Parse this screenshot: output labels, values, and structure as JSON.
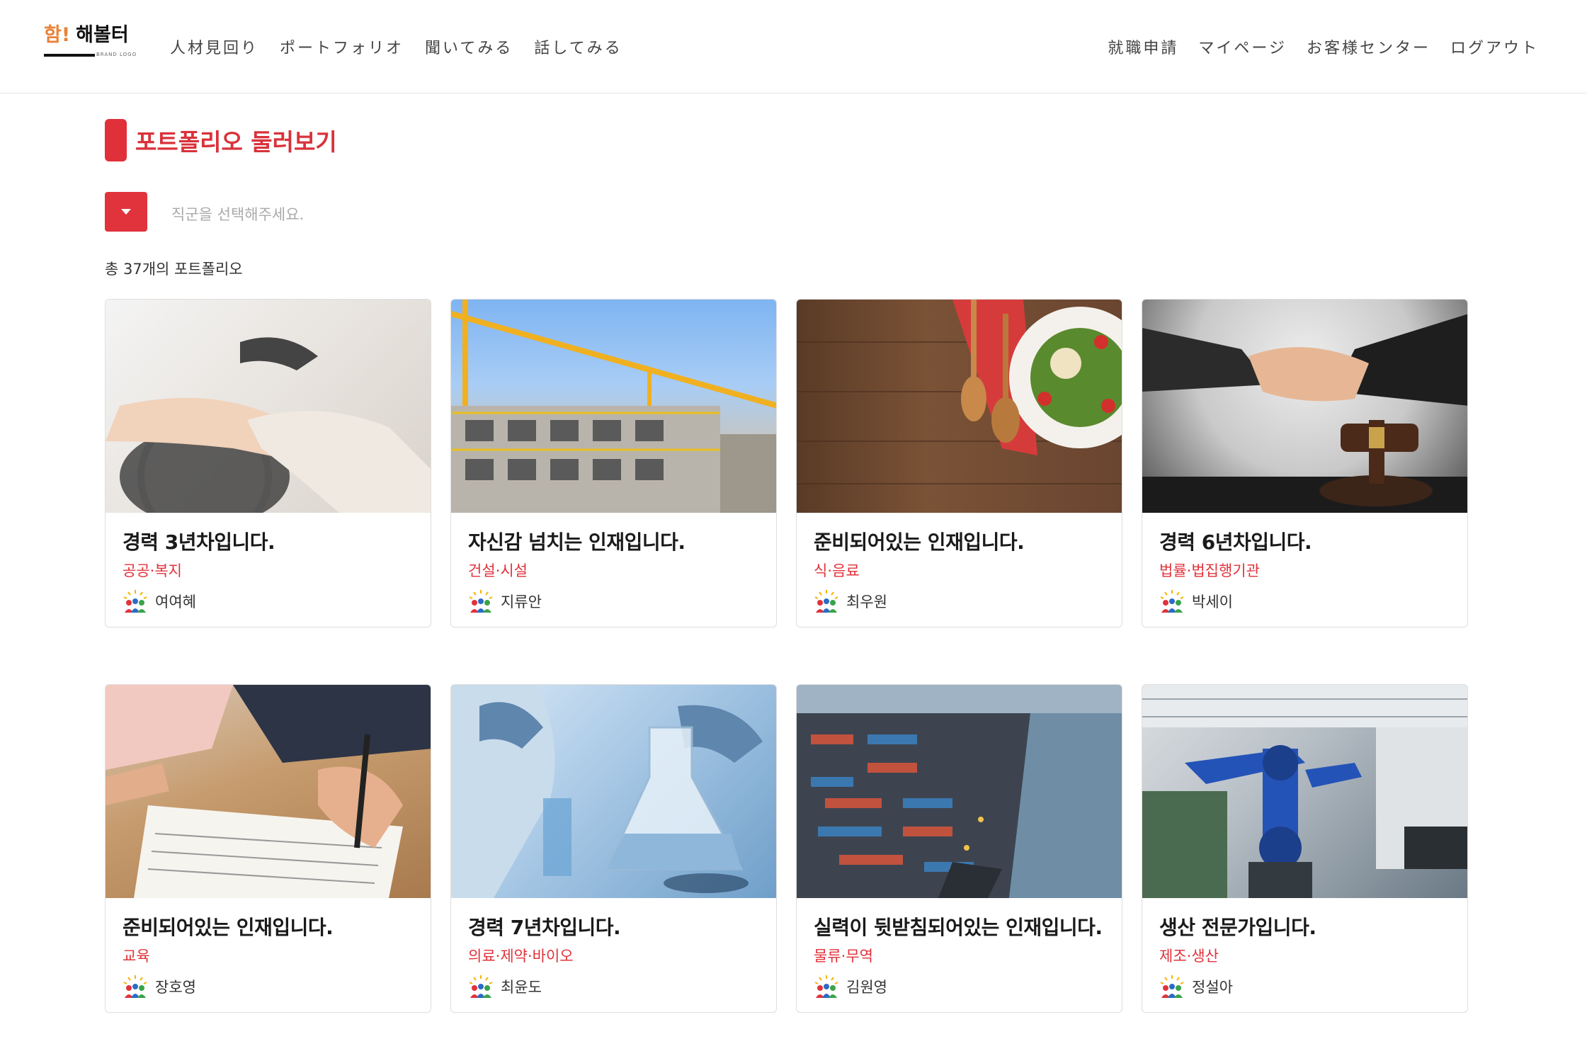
{
  "header": {
    "logo": {
      "ham": "함!",
      "name": "해볼터",
      "sub": "BRAND LOGO"
    },
    "nav_left": [
      "人材見回り",
      "ポートフォリオ",
      "聞いてみる",
      "話してみる"
    ],
    "nav_right": [
      "就職申請",
      "マイページ",
      "お客様センター",
      "ログアウト"
    ]
  },
  "page": {
    "title": "포트폴리오 둘러보기",
    "filter_placeholder": "직군을 선택해주세요.",
    "count_text": "총 37개의 포트폴리오"
  },
  "colors": {
    "accent": "#e0333b",
    "logo_orange": "#e8833a"
  },
  "cards": [
    {
      "title": "경력 3년차입니다.",
      "category": "공공·복지",
      "author": "여여혜",
      "image": "wheelchair-care-photo"
    },
    {
      "title": "자신감 넘치는 인재입니다.",
      "category": "건설·시설",
      "author": "지류안",
      "image": "construction-crane-photo"
    },
    {
      "title": "준비되어있는 인재입니다.",
      "category": "식·음료",
      "author": "최우원",
      "image": "salad-table-photo"
    },
    {
      "title": "경력 6년차입니다.",
      "category": "법률·법집행기관",
      "author": "박세이",
      "image": "handshake-gavel-photo"
    },
    {
      "title": "준비되어있는 인재입니다.",
      "category": "교육",
      "author": "장호영",
      "image": "writing-notes-photo"
    },
    {
      "title": "경력 7년차입니다.",
      "category": "의료·제약·바이오",
      "author": "최윤도",
      "image": "lab-flask-photo"
    },
    {
      "title": "실력이 뒷받침되어있는 인재입니다.",
      "category": "물류·무역",
      "author": "김원영",
      "image": "container-port-photo"
    },
    {
      "title": "생산 전문가입니다.",
      "category": "제조·생산",
      "author": "정설아",
      "image": "factory-robot-photo"
    }
  ]
}
